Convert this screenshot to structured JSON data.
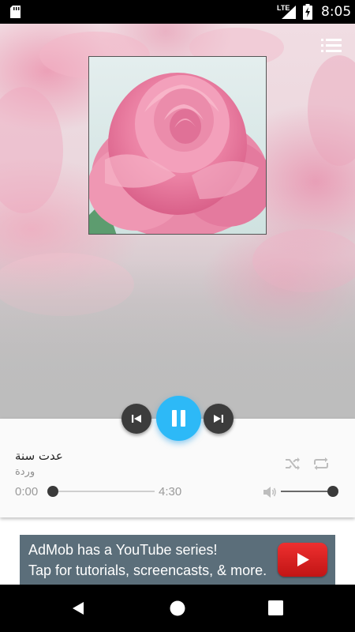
{
  "status_bar": {
    "network": "LTE",
    "time": "8:05",
    "icons": [
      "sd-card-icon",
      "signal-icon",
      "battery-charging-icon"
    ]
  },
  "header": {
    "menu_icon": "playlist-menu-icon"
  },
  "album_art": {
    "icon": "pink-rose-image"
  },
  "controls": {
    "previous_icon": "skip-previous-icon",
    "play_pause_icon": "pause-icon",
    "next_icon": "skip-next-icon",
    "shuffle_icon": "shuffle-icon",
    "repeat_icon": "repeat-icon"
  },
  "track": {
    "title": "عدت سنة",
    "artist": "وردة",
    "current_time": "0:00",
    "total_time": "4:30",
    "progress": 0.0
  },
  "volume": {
    "icon": "volume-icon",
    "level": 1.0
  },
  "ad": {
    "line1": "AdMob has a YouTube series!",
    "line2": "Tap for tutorials, screencasts, & more.",
    "icon": "youtube-play-icon"
  },
  "nav_bar": {
    "icons": [
      "back-icon",
      "home-icon",
      "recents-icon"
    ]
  },
  "colors": {
    "accent": "#2db9f7",
    "card": "#fafafa",
    "ad_background": "#5b6e7a",
    "youtube_red": "#e02020"
  }
}
